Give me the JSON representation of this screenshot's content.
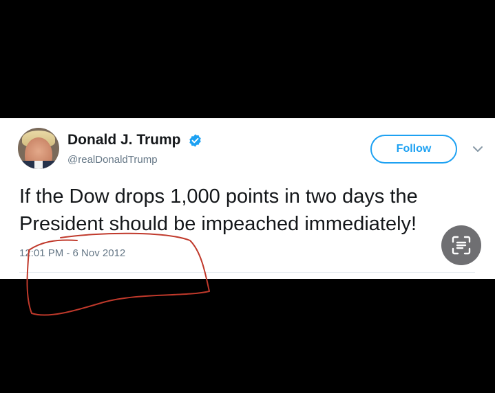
{
  "tweet": {
    "display_name": "Donald J. Trump",
    "handle": "@realDonaldTrump",
    "follow_label": "Follow",
    "text": "If the Dow drops 1,000 points in two days the President should be impeached immediately!",
    "timestamp": "12:01 PM - 6 Nov 2012",
    "verified": true
  },
  "icons": {
    "verified": "verified-badge-icon",
    "caret": "chevron-down-icon",
    "scan": "text-scan-icon"
  },
  "colors": {
    "accent": "#1da1f2",
    "text": "#14171a",
    "secondary": "#657786",
    "annotation": "#c0392b"
  }
}
